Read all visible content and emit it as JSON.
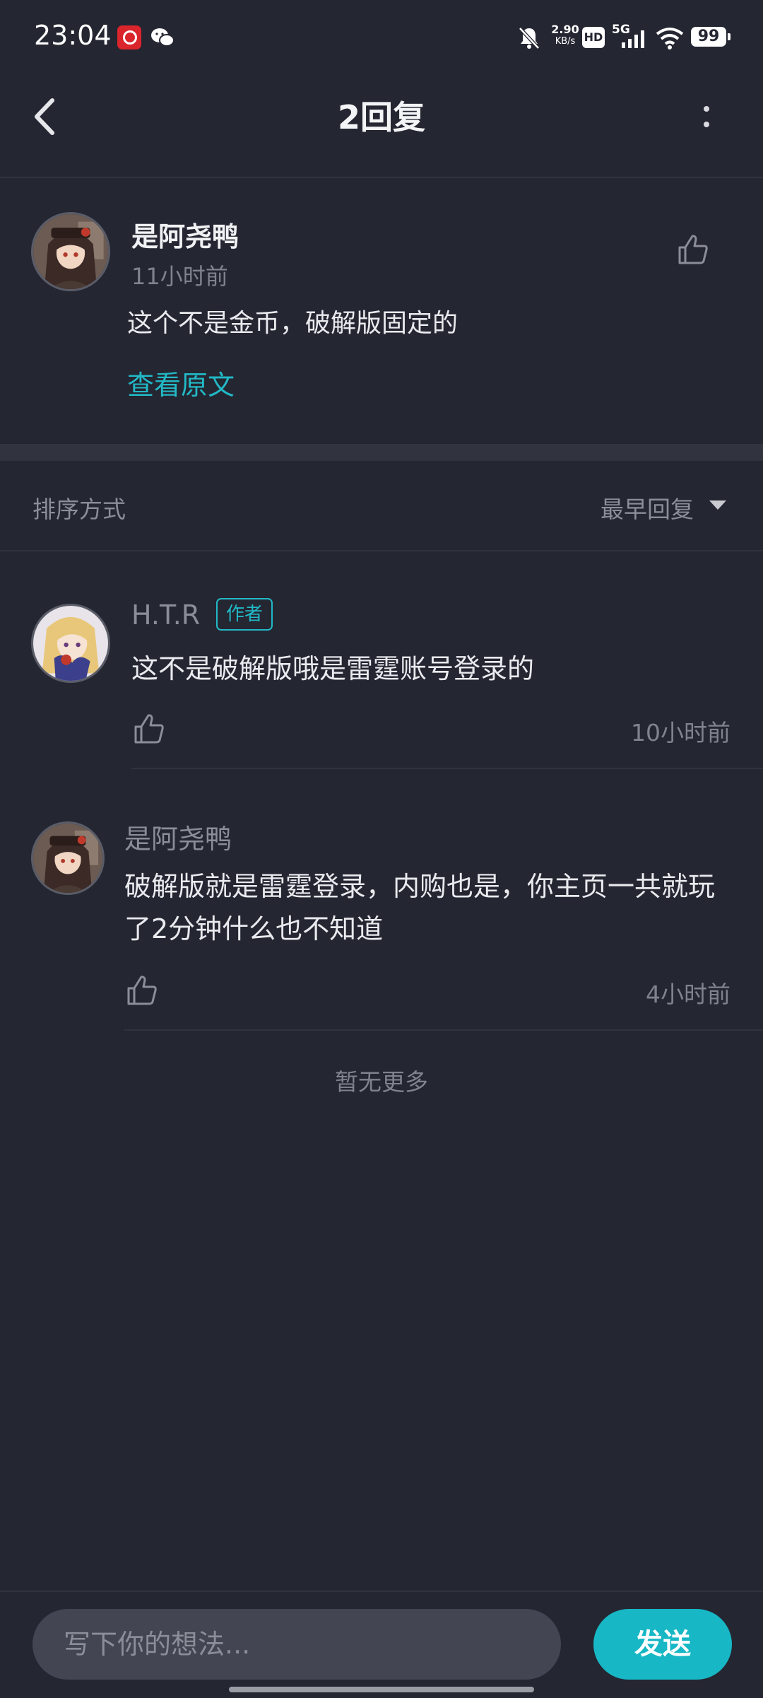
{
  "status_bar": {
    "time": "23:04",
    "net_speed_value": "2.90",
    "net_speed_unit": "KB/s",
    "hd_label": "HD",
    "network_label": "5G",
    "battery": "99"
  },
  "header": {
    "title": "2回复"
  },
  "main_post": {
    "author": "是阿尧鸭",
    "time": "11小时前",
    "text": "这个不是金币，破解版固定的",
    "view_original": "查看原文"
  },
  "sort": {
    "label": "排序方式",
    "selected": "最早回复"
  },
  "replies": [
    {
      "author": "H.T.R",
      "badge": "作者",
      "text": "这不是破解版哦是雷霆账号登录的",
      "time": "10小时前"
    },
    {
      "author": "是阿尧鸭",
      "text": "破解版就是雷霆登录，内购也是，你主页一共就玩了2分钟什么也不知道",
      "time": "4小时前"
    }
  ],
  "footer_note": "暂无更多",
  "composer": {
    "placeholder": "写下你的想法...",
    "send_label": "发送"
  },
  "colors": {
    "background": "#242632",
    "accent": "#22b9c6",
    "send_button": "#17b7c5"
  },
  "icons": [
    "back-arrow-icon",
    "more-vertical-icon",
    "thumbs-up-icon",
    "dropdown-caret-icon",
    "mute-bell-icon",
    "wifi-icon",
    "signal-icon",
    "battery-icon",
    "wechat-icon",
    "netease-music-icon"
  ]
}
